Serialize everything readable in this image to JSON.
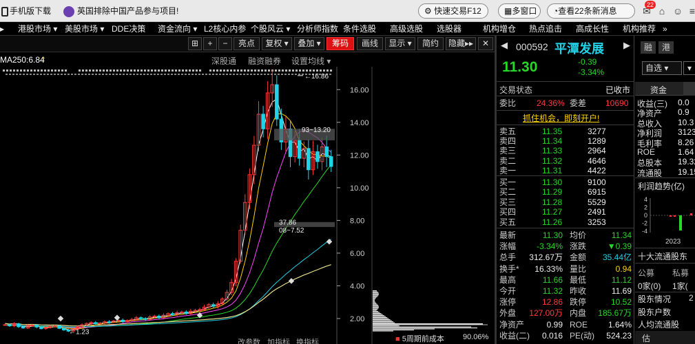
{
  "topbar": {
    "mobile_label": "手机版下载",
    "ad_text": "英国排除中国产品参与项目!",
    "quick_trade": "快速交易F12",
    "multi_window": "多窗口",
    "news": "查看22条新消息",
    "msg_count": "22"
  },
  "menubar": {
    "items": [
      "港股市场 ▾",
      "美股市场 ▾",
      "DDE决策",
      "资金流向 ▾",
      "L2核心内参",
      "个股风云 ▾",
      "分析师指数",
      "条件选股",
      "高级选股",
      "选股器",
      "机构增仓",
      "热点追击",
      "高成长性",
      "机构推荐"
    ],
    "more": "»"
  },
  "charttb": {
    "buttons": [
      "亮点",
      "复权 ▾",
      "叠加 ▾",
      "筹码",
      "画线",
      "显示 ▾",
      "简约",
      "隐藏"
    ],
    "right_tools": [
      "深股通",
      "融资融券",
      "设置均线 ▾"
    ]
  },
  "indicator": {
    "label": "MA250:6.84"
  },
  "chart_data": {
    "type": "candlestick",
    "y_ticks": [
      2,
      4,
      6,
      8,
      10,
      12,
      14,
      16
    ],
    "ylim": [
      1.2,
      17.4
    ],
    "annotations": [
      "16.86",
      "1.23",
      "93~13.20",
      "37.86",
      "08~7.52"
    ],
    "bottom_labels": [
      "改参数",
      "加指标",
      "换指标"
    ],
    "chip_label": "5周期前成本",
    "chip_pct": "90.06%",
    "close_series": [
      1.62,
      1.55,
      1.68,
      1.5,
      1.42,
      1.58,
      1.6,
      1.48,
      1.38,
      1.45,
      1.52,
      1.55,
      1.4,
      1.3,
      1.23,
      1.35,
      1.48,
      1.62,
      1.7,
      1.75,
      1.68,
      1.72,
      1.8,
      1.78,
      1.85,
      1.9,
      1.82,
      1.88,
      1.95,
      2.05,
      2.0,
      1.95,
      2.1,
      2.15,
      2.05,
      2.2,
      2.3,
      2.25,
      2.35,
      2.4,
      2.3,
      2.45,
      2.5,
      2.55,
      2.7,
      2.85,
      2.75,
      2.9,
      3.2,
      3.6,
      4.2,
      5.5,
      7.4,
      9.1,
      10.8,
      12.6,
      14.5,
      13.6,
      15.8,
      16.3,
      14.2,
      12.8,
      13.6,
      11.9,
      12.9,
      11.8,
      12.4,
      11.1,
      12.2,
      11.6,
      12.5,
      11.9,
      11.3
    ]
  },
  "quote": {
    "code": "000592",
    "name": "平潭发展",
    "tags": [
      "融",
      "港"
    ],
    "price": "11.30",
    "change": "-0.39",
    "change_pct": "-3.34%",
    "select_label": "自选",
    "status_label": "交易状态",
    "status_value": "已收市",
    "ratio_label": "委比",
    "ratio_value": "24.36%",
    "diff_label": "委差",
    "diff_value": "10690",
    "promo": "抓住机会，即刻开户!"
  },
  "order_book": {
    "asks": [
      {
        "label": "卖五",
        "price": "11.35",
        "vol": "3277"
      },
      {
        "label": "卖四",
        "price": "11.34",
        "vol": "1289"
      },
      {
        "label": "卖三",
        "price": "11.33",
        "vol": "2964"
      },
      {
        "label": "卖二",
        "price": "11.32",
        "vol": "4646"
      },
      {
        "label": "卖一",
        "price": "11.31",
        "vol": "4422"
      }
    ],
    "bids": [
      {
        "label": "买一",
        "price": "11.30",
        "vol": "9100"
      },
      {
        "label": "买二",
        "price": "11.29",
        "vol": "6915"
      },
      {
        "label": "买三",
        "price": "11.28",
        "vol": "5529"
      },
      {
        "label": "买四",
        "price": "11.27",
        "vol": "2491"
      },
      {
        "label": "买五",
        "price": "11.26",
        "vol": "3253"
      }
    ]
  },
  "stats": [
    {
      "l1": "最新",
      "v1": "11.30",
      "c1": "green",
      "l2": "均价",
      "v2": "11.34",
      "c2": "green"
    },
    {
      "l1": "涨幅",
      "v1": "-3.34%",
      "c1": "green",
      "l2": "涨跌",
      "v2": "▼0.39",
      "c2": "green"
    },
    {
      "l1": "总手",
      "v1": "312.67万",
      "c1": "white",
      "l2": "金额",
      "v2": "35.44亿",
      "c2": "cyan"
    },
    {
      "l1": "换手*",
      "v1": "16.33%",
      "c1": "white",
      "l2": "量比",
      "v2": "0.94",
      "c2": "yellow"
    },
    {
      "l1": "最高",
      "v1": "11.66",
      "c1": "green",
      "l2": "最低",
      "v2": "11.12",
      "c2": "green"
    },
    {
      "l1": "今开",
      "v1": "11.32",
      "c1": "green",
      "l2": "昨收",
      "v2": "11.69",
      "c2": "white"
    },
    {
      "l1": "涨停",
      "v1": "12.86",
      "c1": "red",
      "l2": "跌停",
      "v2": "10.52",
      "c2": "green"
    },
    {
      "l1": "外盘",
      "v1": "127.00万",
      "c1": "red",
      "l2": "内盘",
      "v2": "185.67万",
      "c2": "green"
    },
    {
      "l1": "净资产",
      "v1": "0.99",
      "c1": "white",
      "l2": "ROE",
      "v2": "1.64%",
      "c2": "white"
    },
    {
      "l1": "收益(二)",
      "v1": "0.016",
      "c1": "white",
      "l2": "PE(动)",
      "v2": "524.23",
      "c2": "white"
    }
  ],
  "side": {
    "tab": "资金",
    "fin_labels": [
      "收益(三)",
      "净资产",
      "总收入",
      "净利润",
      "毛利率",
      "ROE",
      "总股本",
      "流通股"
    ],
    "fin_values": [
      "0.0",
      "0.9",
      "10.3",
      "3123",
      "8.26",
      "1.64",
      "19.32",
      "19.15"
    ],
    "profit_title": "利润趋势(亿)",
    "profit_ticks": [
      "4",
      "2",
      "0",
      "-2",
      "-4"
    ],
    "profit_year": "2023",
    "holders_title": "十大流通股东",
    "h_cols": [
      "公募",
      "私募"
    ],
    "h_vals": [
      "0家(0)",
      "1家("
    ],
    "h_items": [
      "股东情况",
      "股东户数",
      "人均流通股"
    ],
    "h_item_vals": [
      "2",
      "",
      ""
    ],
    "bottom": "估"
  }
}
